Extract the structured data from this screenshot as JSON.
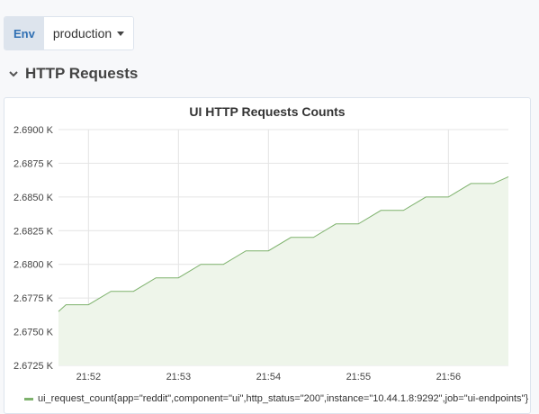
{
  "variable": {
    "label": "Env",
    "value": "production"
  },
  "row": {
    "title": "HTTP Requests"
  },
  "panel": {
    "title": "UI HTTP Requests Counts"
  },
  "legend": {
    "label": "ui_request_count{app=\"reddit\",component=\"ui\",http_status=\"200\",instance=\"10.44.1.8:9292\",job=\"ui-endpoints\"}"
  },
  "colors": {
    "series": "#7eb26d",
    "fill": "#eef5ea",
    "grid": "#e4e4e4",
    "accent": "#2f6fb3"
  },
  "chart_data": {
    "type": "line",
    "title": "UI HTTP Requests Counts",
    "y_ticks": [
      "2.6725 K",
      "2.6750 K",
      "2.6775 K",
      "2.6800 K",
      "2.6825 K",
      "2.6850 K",
      "2.6875 K",
      "2.6900 K"
    ],
    "x_ticks": [
      "21:52",
      "21:53",
      "21:54",
      "21:55",
      "21:56"
    ],
    "ylim": [
      2672.5,
      2690.0
    ],
    "xlim": [
      "21:51:40",
      "21:56:40"
    ],
    "series": [
      {
        "name": "ui_request_count{app=\"reddit\",component=\"ui\",http_status=\"200\",instance=\"10.44.1.8:9292\",job=\"ui-endpoints\"}",
        "x": [
          "21:51:40",
          "21:51:45",
          "21:52:00",
          "21:52:15",
          "21:52:30",
          "21:52:45",
          "21:53:00",
          "21:53:15",
          "21:53:30",
          "21:53:45",
          "21:54:00",
          "21:54:15",
          "21:54:30",
          "21:54:45",
          "21:55:00",
          "21:55:15",
          "21:55:30",
          "21:55:45",
          "21:56:00",
          "21:56:15",
          "21:56:30",
          "21:56:40"
        ],
        "values": [
          2676.5,
          2677,
          2677,
          2678,
          2678,
          2679,
          2679,
          2680,
          2680,
          2681,
          2681,
          2682,
          2682,
          2683,
          2683,
          2684,
          2684,
          2685,
          2685,
          2686,
          2686,
          2686.5
        ]
      }
    ],
    "grid": true,
    "legend": "bottom"
  }
}
